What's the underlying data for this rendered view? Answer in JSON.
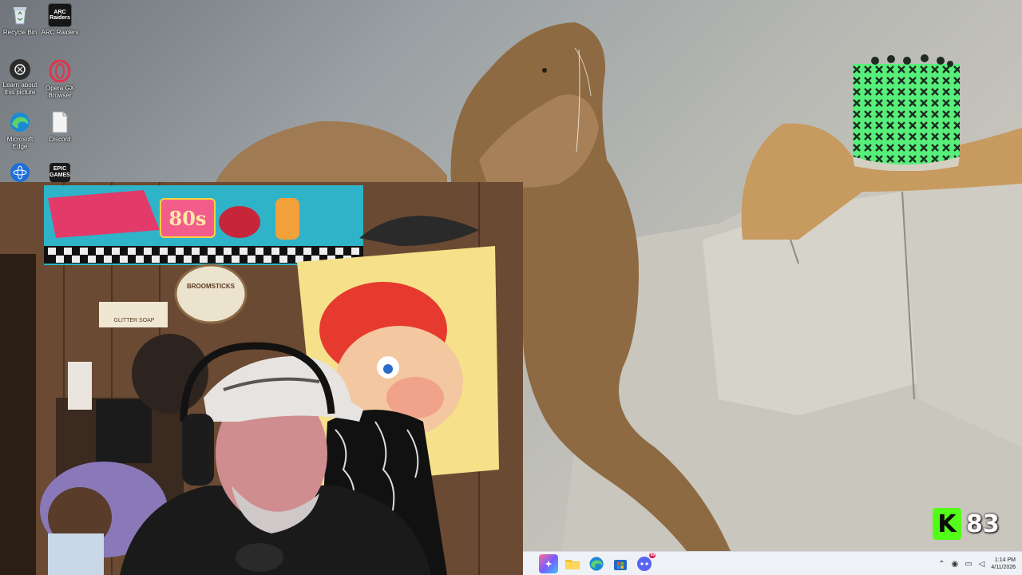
{
  "desktop": {
    "icons": [
      {
        "label": "Recycle Bin",
        "icon": "recycle-bin-icon"
      },
      {
        "label": "ARC Raiders",
        "icon": "arc-raiders-icon",
        "tile_text": "ARC Raiders"
      },
      {
        "label": "Learn about this picture",
        "icon": "camera-info-icon"
      },
      {
        "label": "Opera GX Browser",
        "icon": "opera-gx-icon"
      },
      {
        "label": "Microsoft Edge",
        "icon": "edge-icon"
      },
      {
        "label": "Discord",
        "icon": "file-icon"
      },
      {
        "label": "",
        "icon": "atom-app-icon"
      },
      {
        "label": "",
        "icon": "epic-games-icon",
        "tile_text": "EPIC GAMES"
      }
    ]
  },
  "webcam": {
    "banner_text": "80s",
    "signs": [
      "BROOMSTICKS",
      "GLITTER SOAP"
    ]
  },
  "kick": {
    "logo_letter": "K",
    "viewer_count": "83",
    "color": "#53fc18"
  },
  "taskbar": {
    "apps": [
      {
        "name": "copilot-icon",
        "color": "#7b5cff"
      },
      {
        "name": "file-explorer-icon",
        "color": "#f2c230"
      },
      {
        "name": "edge-icon",
        "color": "#1b8ad6"
      },
      {
        "name": "microsoft-store-icon",
        "color": "#2a66c8"
      },
      {
        "name": "discord-icon",
        "color": "#5865f2",
        "badge": "99"
      }
    ],
    "tray": {
      "time": "1:14 PM",
      "date": "4/11/2026"
    }
  }
}
